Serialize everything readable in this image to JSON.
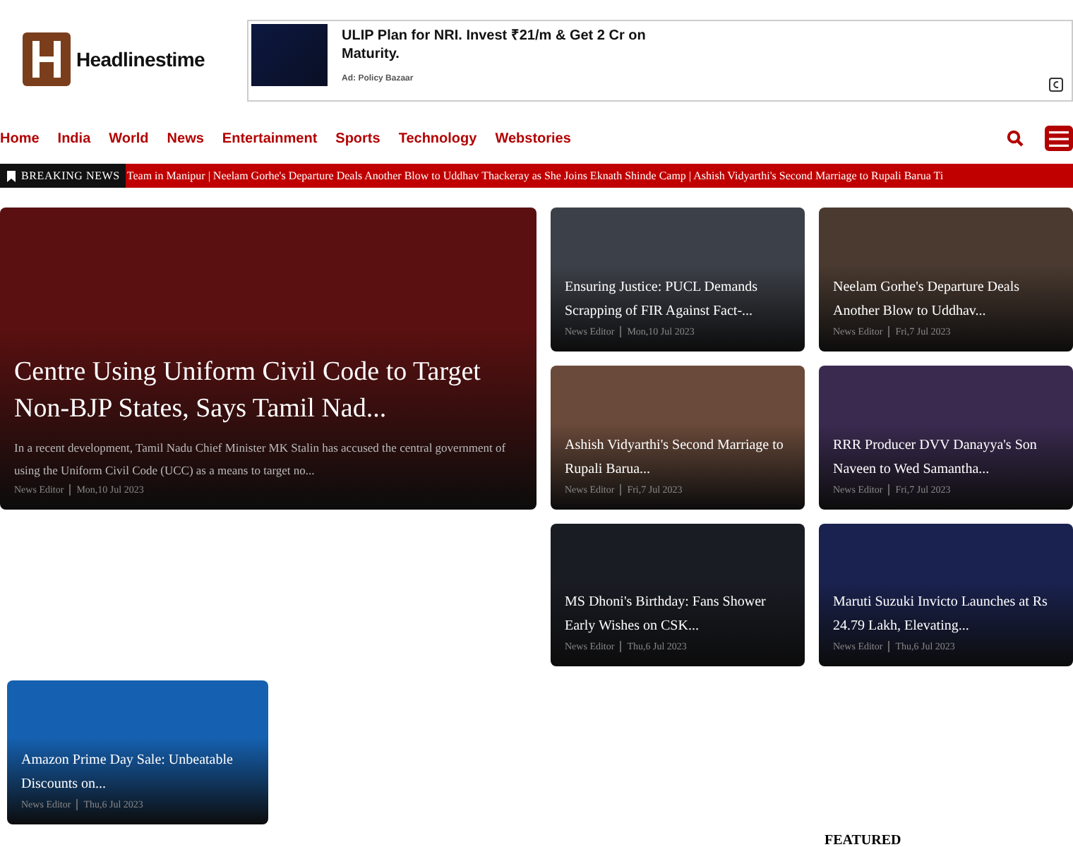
{
  "logo": {
    "name": "Headlinestime"
  },
  "ad": {
    "title": "ULIP Plan for NRI. Invest ₹21/m & Get 2 Cr on Maturity.",
    "source": "Ad: Policy Bazaar"
  },
  "nav": {
    "items": [
      {
        "label": "Home"
      },
      {
        "label": "India"
      },
      {
        "label": "World"
      },
      {
        "label": "News"
      },
      {
        "label": "Entertainment"
      },
      {
        "label": "Sports"
      },
      {
        "label": "Technology"
      },
      {
        "label": "Webstories"
      }
    ]
  },
  "breaking": {
    "label": "BREAKING NEWS",
    "ticker": "Team in Manipur | Neelam Gorhe's Departure Deals Another Blow to Uddhav Thackeray as She Joins Eknath Shinde Camp | Ashish Vidyarthi's Second Marriage to Rupali Barua Ti"
  },
  "stories": [
    {
      "kind": "main",
      "title": "Centre Using Uniform Civil Code to Target Non-BJP States, Says Tamil Nad...",
      "summary": "In a recent development, Tamil Nadu Chief Minister MK Stalin has accused the central government of using the Uniform Civil Code (UCC) as a means to target no...",
      "author": "News Editor",
      "date": "Mon,10 Jul 2023",
      "color": "#5a1010"
    },
    {
      "kind": "card",
      "title": "Ensuring Justice: PUCL Demands Scrapping of FIR Against Fact-...",
      "author": "News Editor",
      "date": "Mon,10 Jul 2023",
      "color": "#3c4048"
    },
    {
      "kind": "card",
      "title": "Neelam Gorhe's Departure Deals Another Blow to Uddhav...",
      "author": "News Editor",
      "date": "Fri,7 Jul 2023",
      "color": "#4a3a30"
    },
    {
      "kind": "card",
      "title": "Ashish Vidyarthi's Second Marriage to Rupali Barua...",
      "author": "News Editor",
      "date": "Fri,7 Jul 2023",
      "color": "#6a4a3a"
    },
    {
      "kind": "card",
      "title": "RRR Producer DVV Danayya's Son Naveen to Wed Samantha...",
      "author": "News Editor",
      "date": "Fri,7 Jul 2023",
      "color": "#3a2a50"
    },
    {
      "kind": "card",
      "title": "MS Dhoni's Birthday: Fans Shower Early Wishes on CSK...",
      "author": "News Editor",
      "date": "Thu,6 Jul 2023",
      "color": "#1a1c24"
    },
    {
      "kind": "card",
      "title": "Maruti Suzuki Invicto Launches at Rs 24.79 Lakh, Elevating...",
      "author": "News Editor",
      "date": "Thu,6 Jul 2023",
      "color": "#1a2250"
    },
    {
      "kind": "card",
      "title": "Amazon Prime Day Sale: Unbeatable Discounts on...",
      "author": "News Editor",
      "date": "Thu,6 Jul 2023",
      "color": "#1560b0"
    }
  ],
  "featured": {
    "heading": "FEATURED"
  }
}
